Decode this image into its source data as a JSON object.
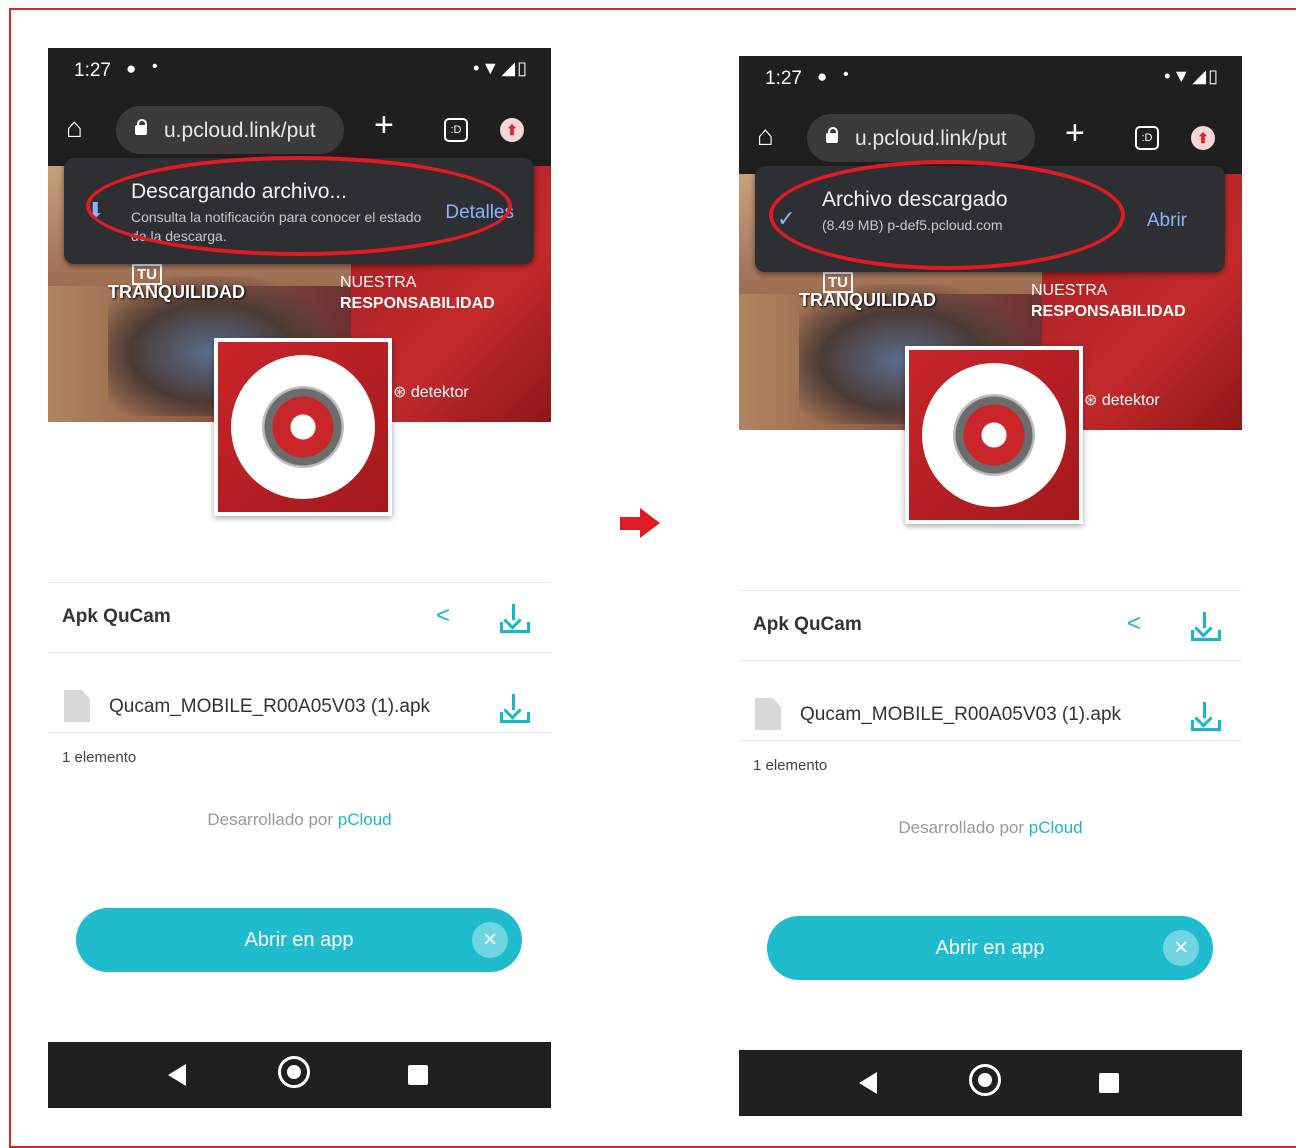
{
  "left": {
    "status_time": "1:27",
    "url": "u.pcloud.link/put",
    "popup": {
      "title": "Descargando archivo...",
      "subtitle": "Consulta la notificación para conocer el estado de la descarga.",
      "action": "Detalles"
    },
    "banner": {
      "tu": "TU",
      "tranquilidad": "TRANQUILIDAD",
      "nuestra": "NUESTRA",
      "responsabilidad": "RESPONSABILIDAD",
      "brand": "⊛ detektor"
    },
    "folder_title": "Apk QuCam",
    "file_name": "Qucam_MOBILE_R00A05V03 (1).apk",
    "count": "1 elemento",
    "powered_prefix": "Desarrollado por",
    "powered_link": "pCloud",
    "open_button": "Abrir en app"
  },
  "right": {
    "status_time": "1:27",
    "url": "u.pcloud.link/put",
    "popup": {
      "title": "Archivo descargado",
      "subtitle": "(8.49 MB) p-def5.pcloud.com",
      "action": "Abrir"
    },
    "banner": {
      "tu": "TU",
      "tranquilidad": "TRANQUILIDAD",
      "nuestra": "NUESTRA",
      "responsabilidad": "RESPONSABILIDAD",
      "brand": "⊛ detektor"
    },
    "folder_title": "Apk QuCam",
    "file_name": "Qucam_MOBILE_R00A05V03 (1).apk",
    "count": "1 elemento",
    "powered_prefix": "Desarrollado por",
    "powered_link": "pCloud",
    "open_button": "Abrir en app"
  },
  "icons": {
    "home": "⌂",
    "plus": "+",
    "tabs": ":D",
    "menu": "⬆",
    "share": "<",
    "close": "×",
    "download_pending": "⬇",
    "download_done": "✓"
  },
  "colors": {
    "accent": "#1fbcce",
    "highlight": "#e21b23",
    "brand_red": "#c7262a"
  }
}
